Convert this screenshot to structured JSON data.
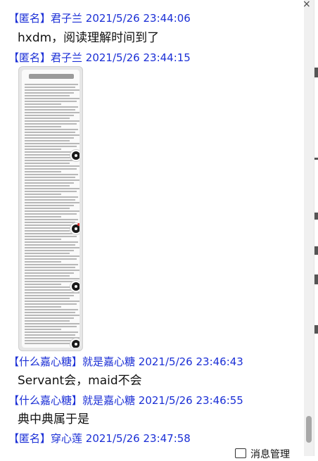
{
  "messages": [
    {
      "sender": "【匿名】君子兰",
      "time": "2021/5/26 23:44:06",
      "text": "hxdm，阅读理解时间到了"
    },
    {
      "sender": "【匿名】君子兰",
      "time": "2021/5/26 23:44:15",
      "text": ""
    },
    {
      "sender": "【什么嘉心糖】就是嘉心糖",
      "time": "2021/5/26 23:46:43",
      "text": "Servant会，maid不会"
    },
    {
      "sender": "【什么嘉心糖】就是嘉心糖",
      "time": "2021/5/26 23:46:55",
      "text": "典中典属于是"
    },
    {
      "sender": "【匿名】穿心莲",
      "time": "2021/5/26 23:47:58",
      "text": ""
    }
  ],
  "close_glyph": "×",
  "bottom_bar": {
    "message_manager": "消息管理"
  }
}
